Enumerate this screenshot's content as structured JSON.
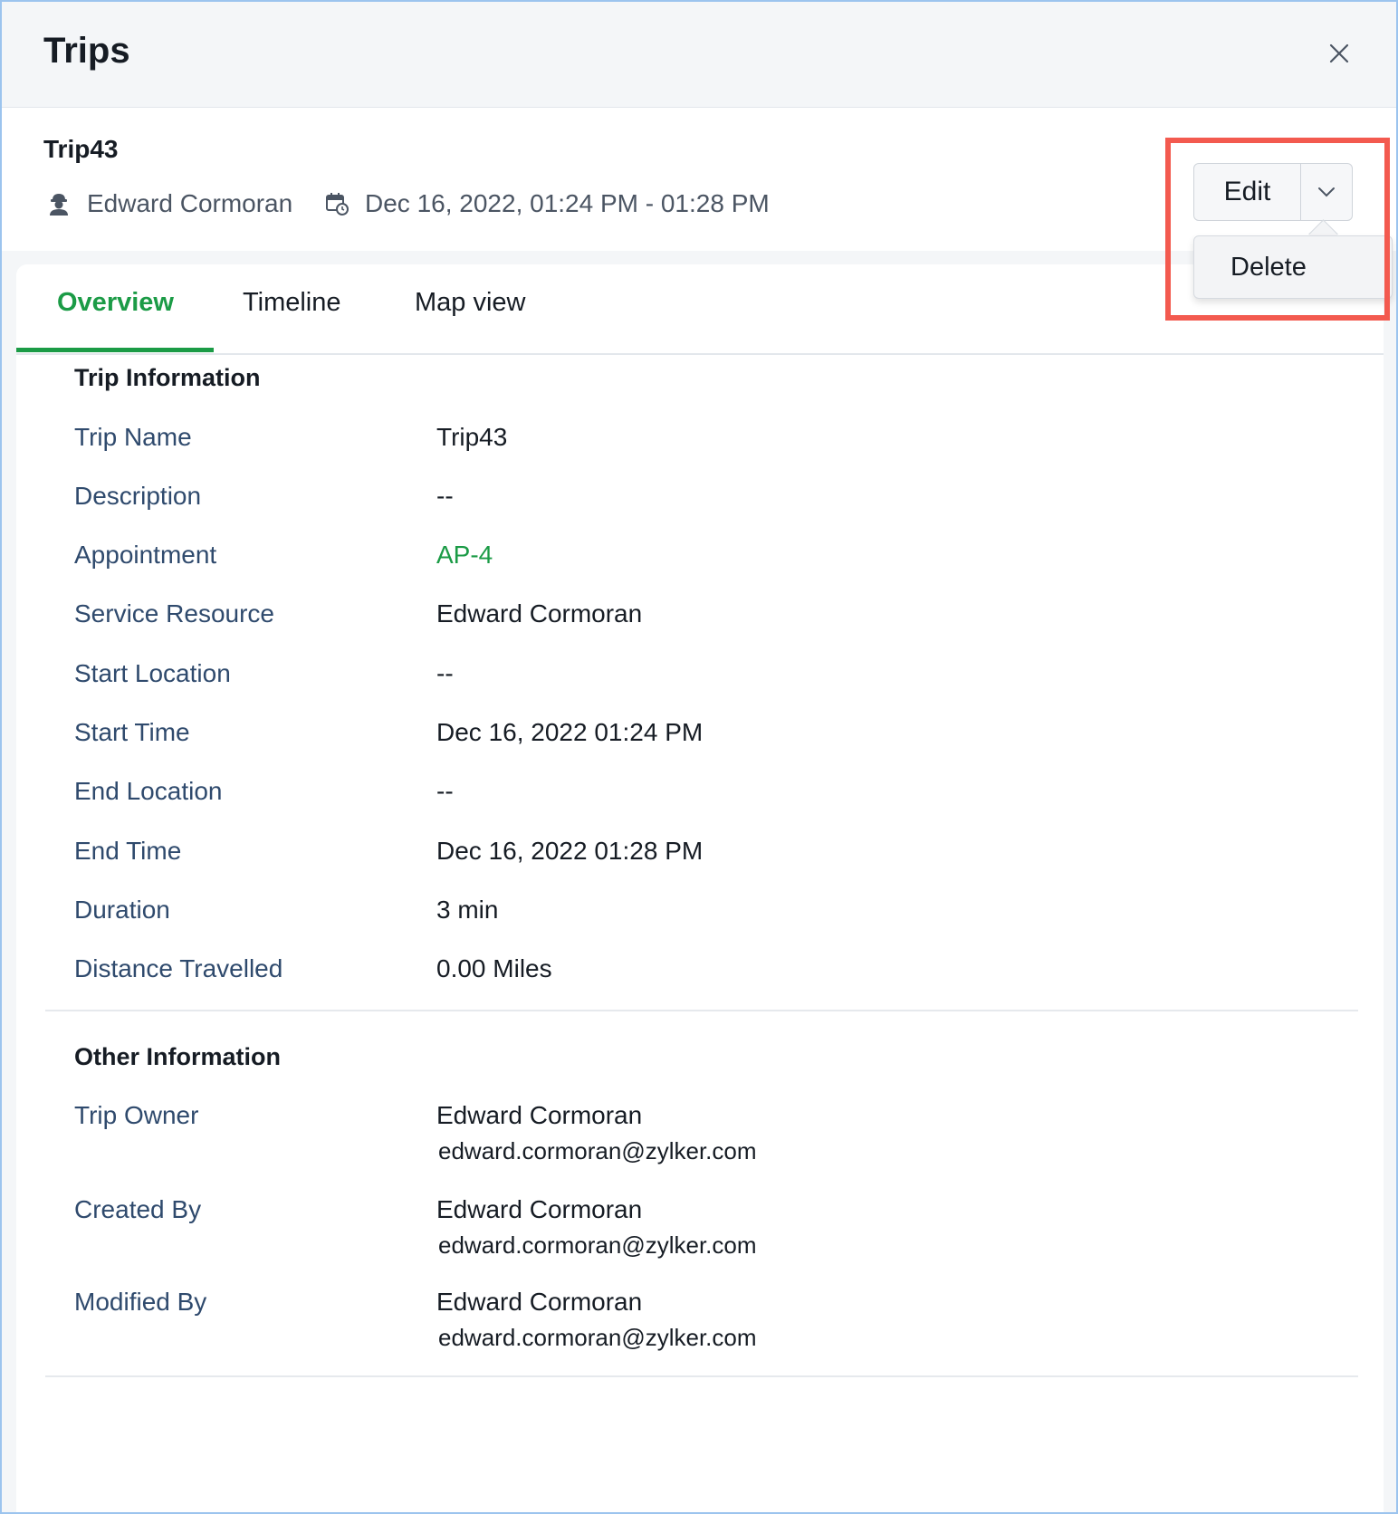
{
  "header": {
    "title": "Trips"
  },
  "record": {
    "title": "Trip43",
    "person": "Edward Cormoran",
    "datetime": "Dec 16, 2022, 01:24 PM - 01:28 PM"
  },
  "actions": {
    "edit_label": "Edit",
    "delete_label": "Delete"
  },
  "tabs": [
    {
      "label": "Overview",
      "active": true
    },
    {
      "label": "Timeline",
      "active": false
    },
    {
      "label": "Map view",
      "active": false
    }
  ],
  "trip_info": {
    "title": "Trip Information",
    "rows": [
      {
        "label": "Trip Name",
        "value": "Trip43"
      },
      {
        "label": "Description",
        "value": "--"
      },
      {
        "label": "Appointment",
        "value": "AP-4"
      },
      {
        "label": "Service Resource",
        "value": "Edward Cormoran"
      },
      {
        "label": "Start Location",
        "value": "--"
      },
      {
        "label": "Start Time",
        "value": "Dec 16, 2022 01:24 PM"
      },
      {
        "label": "End Location",
        "value": "--"
      },
      {
        "label": "End Time",
        "value": "Dec 16, 2022 01:28 PM"
      },
      {
        "label": "Duration",
        "value": "3 min"
      },
      {
        "label": "Distance Travelled",
        "value": "0.00 Miles"
      }
    ]
  },
  "other_info": {
    "title": "Other Information",
    "rows": [
      {
        "label": "Trip Owner",
        "name": "Edward Cormoran",
        "email": "edward.cormoran@zylker.com"
      },
      {
        "label": "Created By",
        "name": "Edward Cormoran",
        "email": "edward.cormoran@zylker.com"
      },
      {
        "label": "Modified By",
        "name": "Edward Cormoran",
        "email": "edward.cormoran@zylker.com"
      }
    ]
  },
  "colors": {
    "accent": "#1b9b46",
    "label": "#2f4a6d",
    "highlight": "#f35a4f"
  }
}
